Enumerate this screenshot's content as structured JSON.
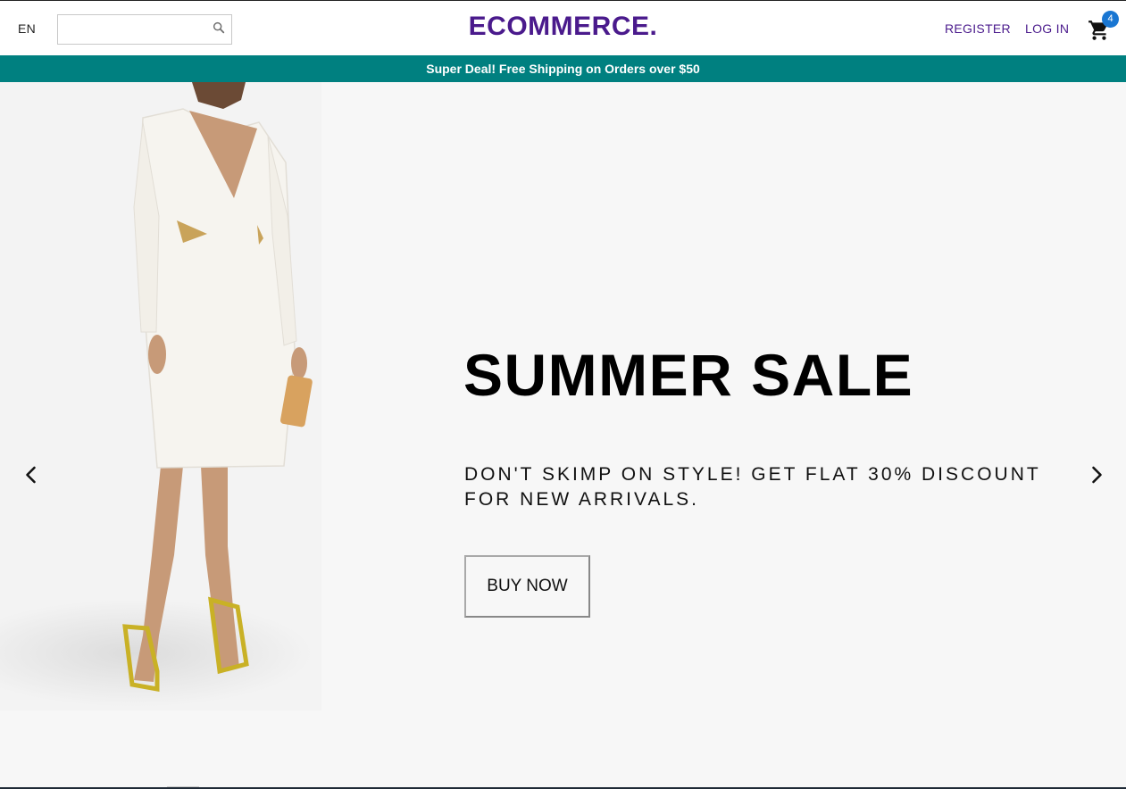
{
  "navbar": {
    "language": "EN",
    "search_placeholder": "",
    "logo": "ECOMMERCE.",
    "register": "REGISTER",
    "login": "LOG IN",
    "cart_count": "4"
  },
  "announcement": "Super Deal! Free Shipping on Orders over $50",
  "slider": {
    "title": "SUMMER SALE",
    "description": "DON'T SKIMP ON STYLE! GET FLAT 30% DISCOUNT FOR NEW ARRIVALS.",
    "button_label": "BUY NOW"
  },
  "colors": {
    "brand": "#4a1a8c",
    "announcement_bg": "#008080",
    "badge": "#1976d2",
    "slider_bg": "#f7f7f7"
  },
  "icons": {
    "search": "search-icon",
    "cart": "shopping-cart-icon",
    "prev": "chevron-left-icon",
    "next": "chevron-right-icon"
  }
}
